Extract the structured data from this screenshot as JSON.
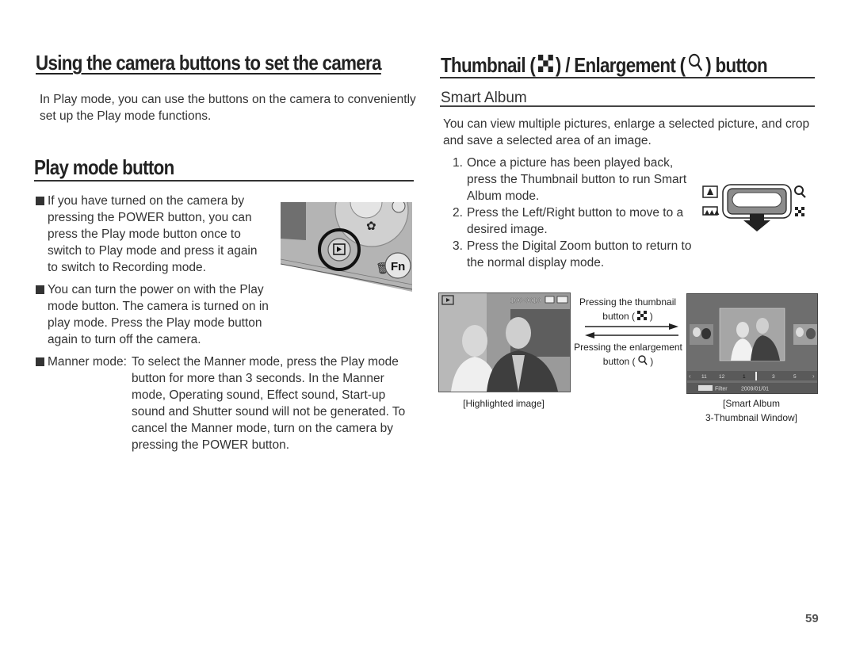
{
  "left": {
    "title": "Using the camera buttons to set the camera",
    "intro": "In Play mode, you can use the buttons on the camera to conveniently set up the Play mode functions.",
    "section_title": "Play mode button",
    "bullets": [
      "If you have turned on the camera by pressing the POWER button, you can press the Play mode button once to switch to Play mode and press it again to switch to Recording mode.",
      "You can turn the power on with the Play mode button. The camera is turned on in play mode. Press the Play mode button again to turn off the camera."
    ],
    "manner": {
      "label": "Manner mode:",
      "text": "To select the Manner mode, press the Play mode button for more than 3 seconds. In the Manner mode, Operating sound, Effect sound, Start-up sound and Shutter sound will not be generated. To cancel the Manner mode, turn on the camera by pressing the POWER button."
    },
    "camera_illustration": {
      "button_label": "Fn"
    }
  },
  "right": {
    "title_part1": "Thumbnail (",
    "title_part2": ") / Enlargement (",
    "title_part3": ") button",
    "subtitle": "Smart Album",
    "intro": "You can view multiple pictures, enlarge a selected picture, and crop and save a selected area of an image.",
    "steps": [
      {
        "num": "1.",
        "text": "Once a picture has been played back, press the Thumbnail button to run Smart Album mode."
      },
      {
        "num": "2.",
        "text": "Press the Left/Right button to move to a desired image."
      },
      {
        "num": "3.",
        "text": "Press the Digital Zoom button to return to the normal display mode."
      }
    ],
    "diagram": {
      "arrow_top_line1": "Pressing the thumbnail",
      "arrow_top_line2_a": "button (",
      "arrow_top_line2_b": ")",
      "arrow_bottom_line1": "Pressing the enlargement",
      "arrow_bottom_line2_a": "button (",
      "arrow_bottom_line2_b": ")",
      "left_screen": {
        "file_number": "100-0010",
        "caption": "[Highlighted image]"
      },
      "right_screen": {
        "timeline": [
          "11",
          "12",
          "1",
          "3",
          "5"
        ],
        "filter_label": "Filter",
        "date": "2009/01/01",
        "caption_line1": "[Smart Album",
        "caption_line2": "3-Thumbnail Window]"
      }
    }
  },
  "footer": {
    "page_number": "59"
  }
}
